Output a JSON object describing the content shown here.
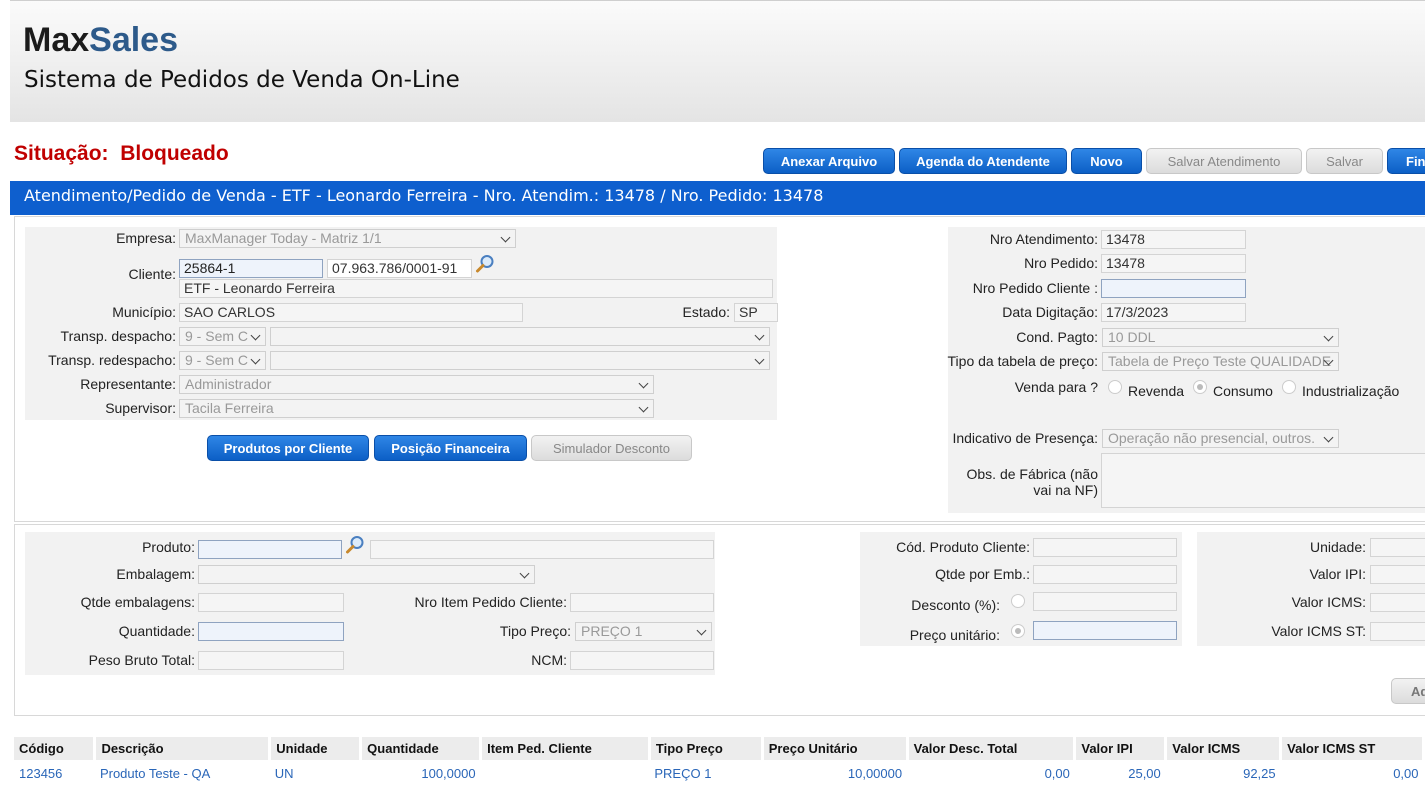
{
  "header": {
    "logo_part1": "Max",
    "logo_part2": "Sales",
    "subtitle": "Sistema de Pedidos de Venda On-Line"
  },
  "status": {
    "label": "Situação:",
    "value": "Bloqueado"
  },
  "toolbar": {
    "anexar": "Anexar Arquivo",
    "agenda": "Agenda do Atendente",
    "novo": "Novo",
    "salvar_atendimento": "Salvar Atendimento",
    "salvar": "Salvar",
    "fin": "Fin"
  },
  "title": "Atendimento/Pedido de Venda - ETF - Leonardo Ferreira - Nro. Atendim.: 13478 / Nro. Pedido: 13478",
  "form": {
    "empresa_label": "Empresa:",
    "empresa": "MaxManager Today - Matriz 1/1",
    "cliente_label": "Cliente:",
    "cliente_code": "25864-1",
    "cliente_cnpj": "07.963.786/0001-91",
    "cliente_name": "ETF - Leonardo Ferreira",
    "municipio_label": "Município:",
    "municipio": "SAO CARLOS",
    "estado_label": "Estado:",
    "estado": "SP",
    "transp_despacho_label": "Transp. despacho:",
    "transp_despacho": "9 - Sem C",
    "transp_redespacho_label": "Transp. redespacho:",
    "transp_redespacho": "9 - Sem C",
    "representante_label": "Representante:",
    "representante": "Administrador",
    "supervisor_label": "Supervisor:",
    "supervisor": "Tacila Ferreira",
    "btn_produtos": "Produtos por Cliente",
    "btn_posicao": "Posição Financeira",
    "btn_simulador": "Simulador Desconto",
    "nro_atendimento_label": "Nro Atendimento:",
    "nro_atendimento": "13478",
    "nro_pedido_label": "Nro Pedido:",
    "nro_pedido": "13478",
    "nro_pedido_cliente_label": "Nro Pedido Cliente :",
    "data_digitacao_label": "Data Digitação:",
    "data_digitacao": "17/3/2023",
    "cond_pagto_label": "Cond. Pagto:",
    "cond_pagto": "10 DDL",
    "tipo_tabela_label": "Tipo da tabela de preço:",
    "tipo_tabela": "Tabela de Preço Teste QUALIDADE",
    "venda_para_label": "Venda para ?",
    "opt_revenda": "Revenda",
    "opt_consumo": "Consumo",
    "opt_industrializacao": "Industrialização",
    "indicativo_label": "Indicativo de Presença:",
    "indicativo": "Operação não presencial, outros.",
    "obs_label_1": "Obs. de Fábrica (não",
    "obs_label_2": "vai na NF)"
  },
  "item": {
    "produto_label": "Produto:",
    "embalagem_label": "Embalagem:",
    "qtde_emb_label": "Qtde embalagens:",
    "quantidade_label": "Quantidade:",
    "peso_label": "Peso Bruto Total:",
    "nro_item_label": "Nro Item Pedido Cliente:",
    "tipo_preco_label": "Tipo Preço:",
    "tipo_preco": "PREÇO 1",
    "ncm_label": "NCM:",
    "cod_prod_cliente_label": "Cód. Produto Cliente:",
    "qtde_por_emb_label": "Qtde por Emb.:",
    "desconto_label": "Desconto (%):",
    "preco_unit_label": "Preço unitário:",
    "unidade_label": "Unidade:",
    "valor_ipi_label": "Valor IPI:",
    "valor_icms_label": "Valor ICMS:",
    "valor_icms_st_label": "Valor ICMS ST:",
    "add_btn": "Ad"
  },
  "grid": {
    "headers": [
      "Código",
      "Descrição",
      "Unidade",
      "Quantidade",
      "Item Ped. Cliente",
      "Tipo Preço",
      "Preço Unitário",
      "Valor Desc. Total",
      "Valor IPI",
      "Valor ICMS",
      "Valor ICMS ST"
    ],
    "rows": [
      [
        "123456",
        "Produto Teste - QA",
        "UN",
        "100,0000",
        "",
        "PREÇO 1",
        "10,00000",
        "0,00",
        "25,00",
        "92,25",
        "0,00"
      ]
    ]
  },
  "colors": {
    "primary_blue": "#0e5fce",
    "status_red": "#c00000",
    "link_blue": "#2a66b8"
  }
}
